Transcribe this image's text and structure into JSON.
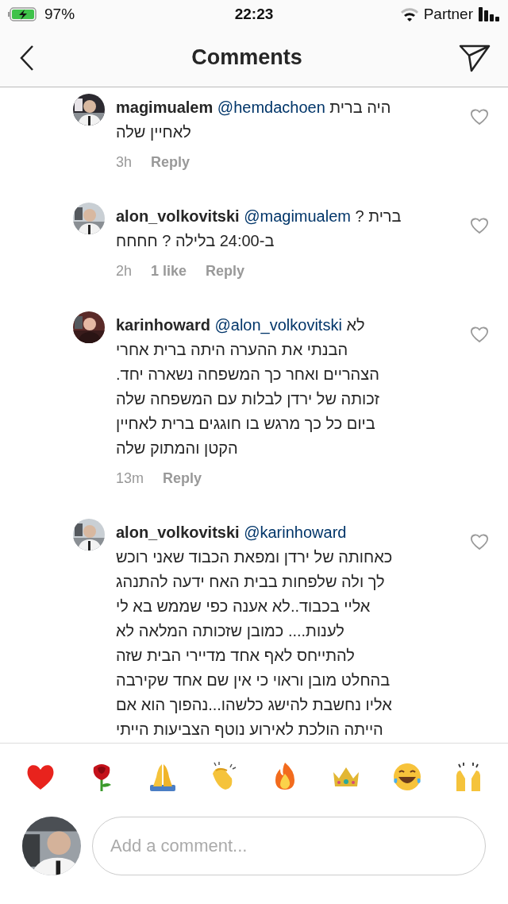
{
  "status_bar": {
    "battery": "97%",
    "time": "22:23",
    "carrier": "Partner"
  },
  "header": {
    "title": "Comments"
  },
  "comments": [
    {
      "username": "magimualem",
      "mention": "@hemdachoen",
      "text": "היה ברית לאחיין שלה",
      "time": "3h",
      "reply": "Reply",
      "liked": false
    },
    {
      "username": "alon_volkovitski",
      "mention": "@magimualem",
      "text": "ברית ? ב-24:00 בלילה ? חחחח",
      "time": "2h",
      "likes": "1 like",
      "reply": "Reply",
      "liked": false
    },
    {
      "username": "karinhoward",
      "mention": "@alon_volkovitski",
      "text": "לא הבנתי את ההערה היתה ברית אחרי הצהריים ואחר כך המשפחה נשארה יחד. זכותה של ירדן לבלות עם המשפחה שלה ביום כל כך מרגש בו חוגגים ברית לאחיין הקטן והמתוק שלה",
      "time": "13m",
      "reply": "Reply",
      "liked": false
    },
    {
      "username": "alon_volkovitski",
      "mention": "@karinhoward",
      "text": "כאחותה של ירדן ומפאת הכבוד שאני רוכש לך ולה שלפחות בבית האח ידעה להתנהג אליי בכבוד..לא אענה כפי שממש בא לי לענות.... כמובן שזכותה המלאה לא להתייחס לאף אחד מדיירי הבית שזה בהחלט מובן וראוי כי אין שם אחד שקירבה אליו נחשבת להישג כלשהו...נהפוך הוא אם הייתה הולכת לאירוע נוטף הצביעות הייתי",
      "liked": false
    }
  ],
  "composer": {
    "placeholder": "Add a comment..."
  }
}
